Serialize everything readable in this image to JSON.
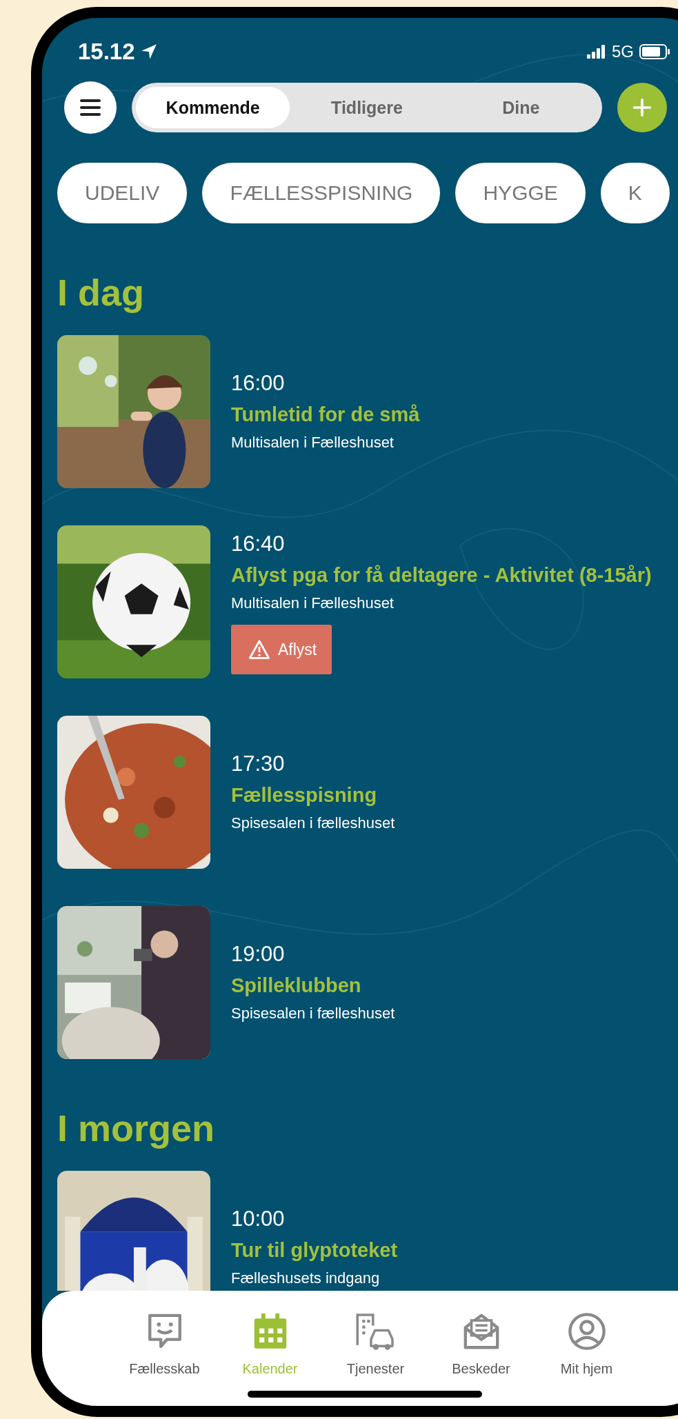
{
  "status_bar": {
    "time": "15.12",
    "network": "5G"
  },
  "segments": [
    {
      "label": "Kommende",
      "selected": true
    },
    {
      "label": "Tidligere",
      "selected": false
    },
    {
      "label": "Dine",
      "selected": false
    }
  ],
  "categories": [
    "UDELIV",
    "FÆLLESSPISNING",
    "HYGGE",
    "K"
  ],
  "sections": [
    {
      "heading": "I dag",
      "events": [
        {
          "time": "16:00",
          "title": "Tumletid for de små",
          "location": "Multisalen i Fælleshuset"
        },
        {
          "time": "16:40",
          "title": "Aflyst pga for få deltagere - Aktivitet (8-15år)",
          "location": "Multisalen i Fælleshuset",
          "badge": "Aflyst"
        },
        {
          "time": "17:30",
          "title": "Fællesspisning",
          "location": "Spisesalen i fælleshuset"
        },
        {
          "time": "19:00",
          "title": "Spilleklubben",
          "location": "Spisesalen i fælleshuset"
        }
      ]
    },
    {
      "heading": "I morgen",
      "events": [
        {
          "time": "10:00",
          "title": "Tur til glyptoteket",
          "location": "Fælleshusets indgang"
        }
      ]
    }
  ],
  "tab_bar": [
    {
      "label": "Fællesskab",
      "selected": false
    },
    {
      "label": "Kalender",
      "selected": true
    },
    {
      "label": "Tjenester",
      "selected": false
    },
    {
      "label": "Beskeder",
      "selected": false
    },
    {
      "label": "Mit hjem",
      "selected": false
    }
  ]
}
